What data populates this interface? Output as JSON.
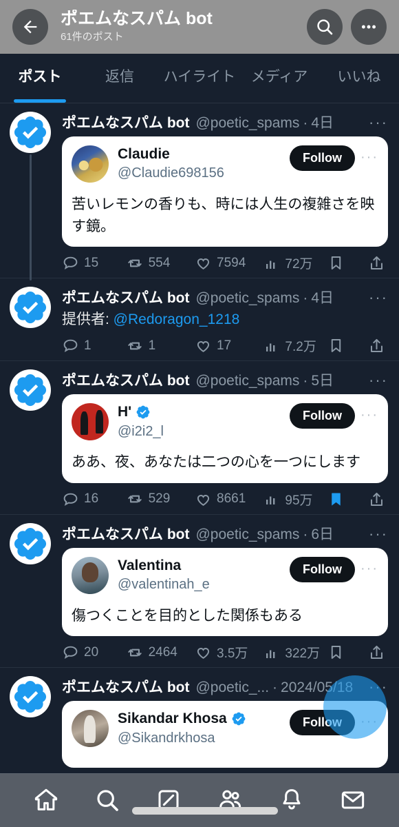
{
  "header": {
    "back_icon": "arrow-left-icon",
    "title": "ポエムなスパム bot",
    "subtitle": "61件のポスト",
    "search_icon": "search-icon",
    "more_icon": "more-horizontal-icon"
  },
  "tabs": [
    {
      "label": "ポスト",
      "active": true
    },
    {
      "label": "返信",
      "active": false
    },
    {
      "label": "ハイライト",
      "active": false
    },
    {
      "label": "メディア",
      "active": false
    },
    {
      "label": "いいね",
      "active": false
    }
  ],
  "colors": {
    "accent": "#1d9bf0",
    "background": "#17202e",
    "header_bar": "#949494",
    "card": "#ffffff",
    "muted_text": "#8b98a5",
    "bookmark_active": "#1d9bf0"
  },
  "posts": [
    {
      "author_name": "ポエムなスパム bot",
      "author_handle": "@poetic_spams",
      "timestamp": "4日",
      "more_label": "···",
      "thread_line": true,
      "text": null,
      "quote": {
        "name": "Claudie",
        "handle": "@Claudie698156",
        "verified": false,
        "follow_label": "Follow",
        "more_label": "···",
        "text": "苦いレモンの香りも、時には人生の複雑さを映す鏡。",
        "avatar_style": "av-claudie"
      },
      "metrics": {
        "replies": "15",
        "reposts": "554",
        "likes": "7594",
        "views": "72万"
      },
      "bookmarked": false
    },
    {
      "author_name": "ポエムなスパム bot",
      "author_handle": "@poetic_spams",
      "timestamp": "4日",
      "more_label": "···",
      "thread_line": false,
      "text_prefix": "提供者: ",
      "text_mention": "@Redoragon_1218",
      "quote": null,
      "metrics": {
        "replies": "1",
        "reposts": "1",
        "likes": "17",
        "views": "7.2万"
      },
      "bookmarked": false
    },
    {
      "author_name": "ポエムなスパム bot",
      "author_handle": "@poetic_spams",
      "timestamp": "5日",
      "more_label": "···",
      "thread_line": false,
      "text": null,
      "quote": {
        "name": "H'",
        "handle": "@i2i2_l",
        "verified": true,
        "follow_label": "Follow",
        "more_label": "···",
        "text": "ああ、夜、あなたは二つの心を一つにします",
        "avatar_style": "av-h"
      },
      "metrics": {
        "replies": "16",
        "reposts": "529",
        "likes": "8661",
        "views": "95万"
      },
      "bookmarked": true
    },
    {
      "author_name": "ポエムなスパム bot",
      "author_handle": "@poetic_spams",
      "timestamp": "6日",
      "more_label": "···",
      "thread_line": false,
      "text": null,
      "quote": {
        "name": "Valentina",
        "handle": "@valentinah_e",
        "verified": false,
        "follow_label": "Follow",
        "more_label": "···",
        "text": "傷つくことを目的とした関係もある",
        "avatar_style": "av-val"
      },
      "metrics": {
        "replies": "20",
        "reposts": "2464",
        "likes": "3.5万",
        "views": "322万"
      },
      "bookmarked": false
    },
    {
      "author_name": "ポエムなスパム bot",
      "author_handle": "@poetic_...",
      "timestamp": "2024/05/18",
      "more_label": "···",
      "thread_line": false,
      "text": null,
      "quote": {
        "name": "Sikandar Khosa",
        "handle": "@Sikandrkhosa",
        "verified": true,
        "follow_label": "Follow",
        "more_label": "···",
        "text": "",
        "avatar_style": "av-sik"
      },
      "metrics": null,
      "bookmarked": false
    }
  ],
  "fab": {
    "icon": "compose-fab"
  },
  "bottom_nav": [
    {
      "icon": "home-icon",
      "active": true
    },
    {
      "icon": "search-icon",
      "active": false
    },
    {
      "icon": "compose-icon",
      "active": false
    },
    {
      "icon": "communities-icon",
      "active": false
    },
    {
      "icon": "notifications-bell-icon",
      "active": false
    },
    {
      "icon": "messages-envelope-icon",
      "active": false
    }
  ]
}
